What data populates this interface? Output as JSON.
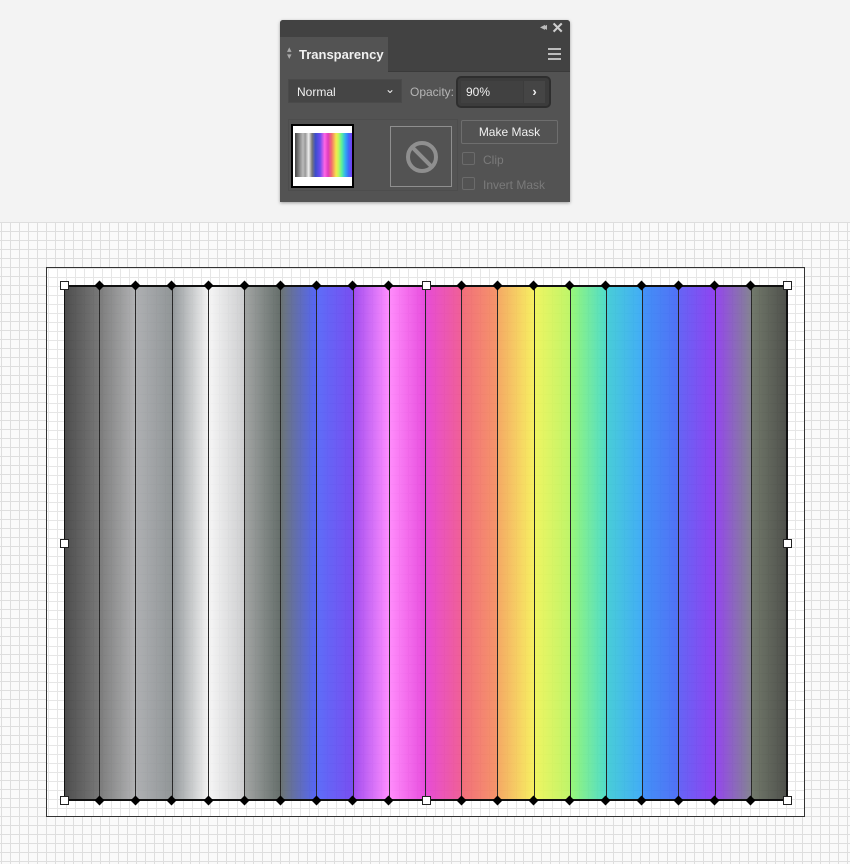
{
  "panel": {
    "title": "Transparency",
    "collapse_icon": "double-chevron-left",
    "close_icon": "close",
    "menu_icon": "hamburger-menu",
    "blend_mode": "Normal",
    "opacity_label": "Opacity:",
    "opacity_value": "90%",
    "opacity_arrow": "›",
    "make_mask_label": "Make Mask",
    "clip_label": "Clip",
    "clip_checked": false,
    "invert_mask_label": "Invert Mask",
    "invert_mask_checked": false,
    "mask_icon": "no-mask-icon"
  },
  "canvas": {
    "object_opacity_percent": 90,
    "stripes": [
      {
        "from": "#3a3a3a",
        "to": "#6a6a6a"
      },
      {
        "from": "#6f6f6f",
        "to": "#a9aaac"
      },
      {
        "from": "#a6a8ab",
        "to": "#868b8d"
      },
      {
        "from": "#8b9093",
        "to": "#f2f2f2"
      },
      {
        "from": "#f5f5f5",
        "to": "#c9cacc"
      },
      {
        "from": "#999c9b",
        "to": "#56605c"
      },
      {
        "from": "#5d6767",
        "to": "#4456f5"
      },
      {
        "from": "#4c5ef8",
        "to": "#6b3cf0"
      },
      {
        "from": "#9a3cee",
        "to": "#ff82ff"
      },
      {
        "from": "#ff80fb",
        "to": "#e63bdb"
      },
      {
        "from": "#e53ad2",
        "to": "#ef4f8c"
      },
      {
        "from": "#f05f6e",
        "to": "#f58a5a"
      },
      {
        "from": "#f5a055",
        "to": "#f6ef52"
      },
      {
        "from": "#eef552",
        "to": "#b8f55a"
      },
      {
        "from": "#8cf66c",
        "to": "#3ed9c4"
      },
      {
        "from": "#36c9d4",
        "to": "#2ea4f5"
      },
      {
        "from": "#2f86f7",
        "to": "#3f62f6"
      },
      {
        "from": "#5554f4",
        "to": "#8530f0"
      },
      {
        "from": "#8a34ec",
        "to": "#777787"
      },
      {
        "from": "#636b5c",
        "to": "#3c3e38"
      }
    ]
  }
}
